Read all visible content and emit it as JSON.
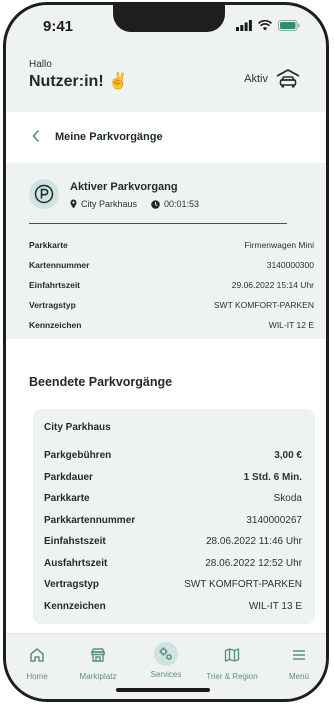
{
  "status_bar": {
    "time": "9:41"
  },
  "header": {
    "greeting": "Hallo",
    "user_name": "Nutzer:in! ✌",
    "status_label": "Aktiv"
  },
  "nav": {
    "title": "Meine Parkvorgänge"
  },
  "active": {
    "title": "Aktiver Parkvorgang",
    "location": "City Parkhaus",
    "duration": "00:01:53",
    "rows": [
      {
        "label": "Parkkarte",
        "value": "Firmenwagen Mini"
      },
      {
        "label": "Kartennummer",
        "value": "3140000300"
      },
      {
        "label": "Einfahrtszeit",
        "value": "29.06.2022  15:14 Uhr"
      },
      {
        "label": "Vertragstyp",
        "value": "SWT KOMFORT-PARKEN"
      },
      {
        "label": "Kennzeichen",
        "value": "WIL-IT 12 E"
      }
    ]
  },
  "ended": {
    "title": "Beendete Parkvorgänge",
    "card": {
      "title": "City Parkhaus",
      "rows": [
        {
          "label": "Parkgebühren",
          "value": "3,00 €"
        },
        {
          "label": "Parkdauer",
          "value": "1 Std. 6 Min."
        },
        {
          "label": "Parkkarte",
          "value": "Skoda"
        },
        {
          "label": "Parkkartennummer",
          "value": "3140000267"
        },
        {
          "label": "Einfahstszeit",
          "value": "28.06.2022  11:46 Uhr"
        },
        {
          "label": "Ausfahrtszeit",
          "value": "28.06.2022  12:52 Uhr"
        },
        {
          "label": "Vertragstyp",
          "value": "SWT KOMFORT-PARKEN"
        },
        {
          "label": "Kennzeichen",
          "value": "WIL-IT 13 E"
        }
      ]
    }
  },
  "tabbar": {
    "active_tab": "Services",
    "tabs": [
      {
        "label": "Home",
        "icon": "home-icon"
      },
      {
        "label": "Marktplatz",
        "icon": "store-icon"
      },
      {
        "label": "Services",
        "icon": "services-icon"
      },
      {
        "label": "Trier & Region",
        "icon": "map-icon"
      },
      {
        "label": "Menü",
        "icon": "menu-icon"
      }
    ]
  },
  "colors": {
    "accent": "#5a8f86",
    "accent_light": "#cfe3df",
    "background": "#eef3f2"
  }
}
